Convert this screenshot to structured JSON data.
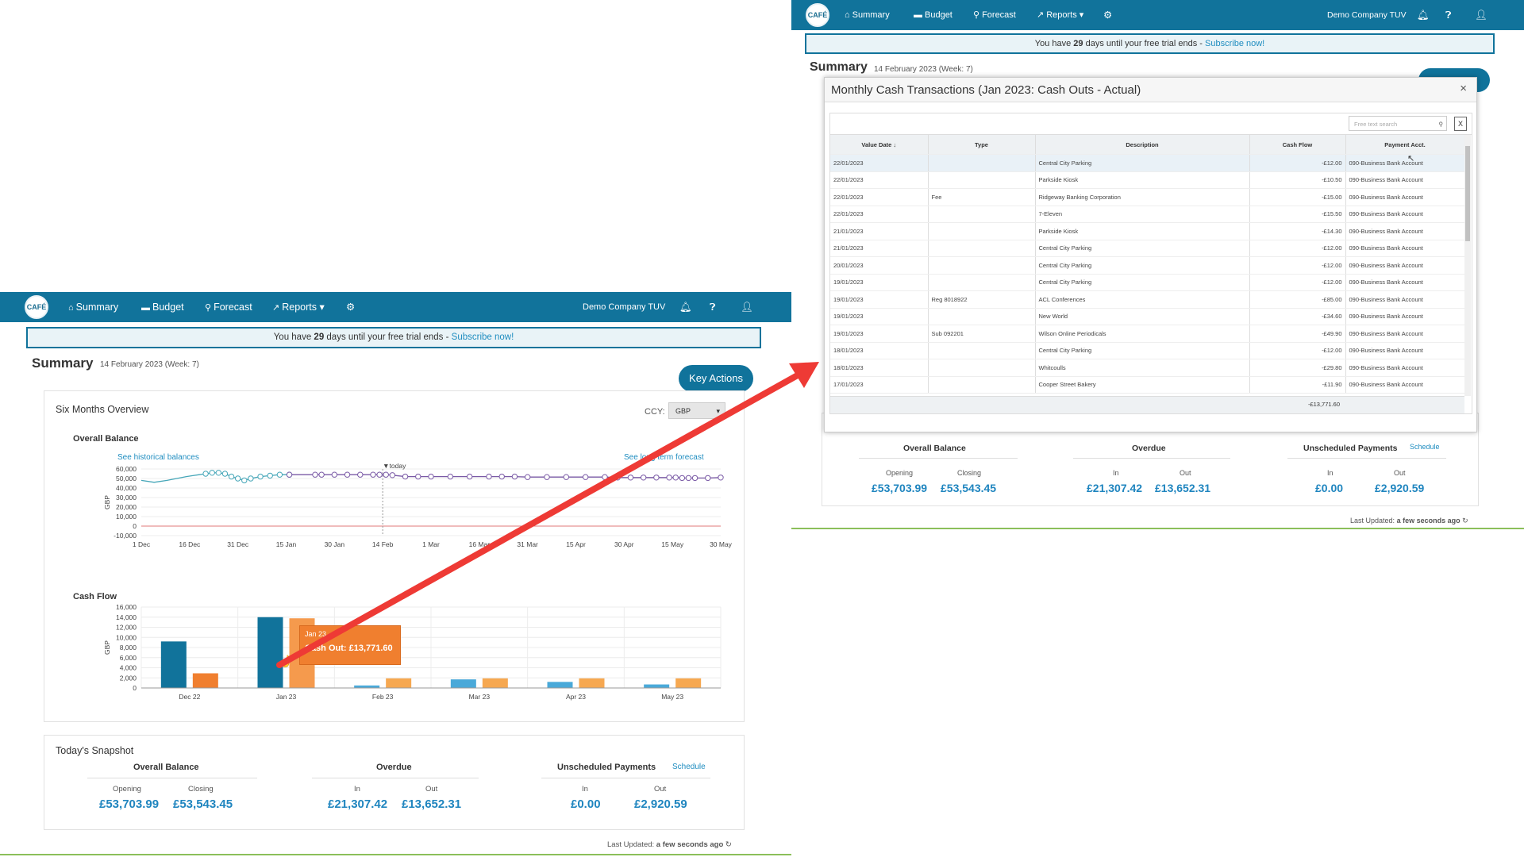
{
  "nav": {
    "logo": "CAFÉ",
    "items": [
      "Summary",
      "Budget",
      "Forecast",
      "Reports ▾"
    ],
    "company": "Demo Company TUV"
  },
  "trial": {
    "pre": "You have ",
    "days": "29",
    "post": " days until your free trial ends",
    "sep": " - ",
    "link": "Subscribe now!"
  },
  "summary": {
    "title": "Summary",
    "subtitle": "14 February 2023  (Week: 7)",
    "key_actions": "Key Actions"
  },
  "overview": {
    "title": "Six Months Overview",
    "ccy_label": "CCY:",
    "ccy_value": "GBP",
    "balance_title": "Overall Balance",
    "historical_link": "See historical balances",
    "forecast_link": "See long term forecast",
    "cashflow_title": "Cash Flow",
    "tooltip_month": "Jan 23",
    "tooltip_text": "Cash Out: £13,771.60"
  },
  "chart_data": [
    {
      "type": "line",
      "title": "Overall Balance",
      "ylabel": "GBP",
      "x_ticks": [
        "1 Dec",
        "16 Dec",
        "31 Dec",
        "15 Jan",
        "30 Jan",
        "14 Feb",
        "1 Mar",
        "16 Mar",
        "31 Mar",
        "15 Apr",
        "30 Apr",
        "15 May",
        "30 May"
      ],
      "y_ticks": [
        -10000,
        0,
        10000,
        20000,
        30000,
        40000,
        50000,
        60000
      ],
      "ylim": [
        -10000,
        60000
      ],
      "annotation": "today",
      "series": [
        {
          "values_x": [
            0,
            4,
            8,
            11,
            14,
            16,
            18,
            20,
            22,
            24,
            26,
            28,
            30,
            32,
            34,
            37,
            40,
            43,
            46
          ],
          "values_y": [
            48000,
            46000,
            48000,
            50000,
            52000,
            53000,
            54000,
            55000,
            56000,
            56000,
            55000,
            52000,
            50000,
            48000,
            50000,
            52000,
            53000,
            54000,
            54000
          ]
        },
        {
          "values_x": [
            46,
            54,
            56,
            60,
            64,
            68,
            72,
            74,
            76,
            78,
            82,
            86,
            90,
            96,
            102,
            108,
            112,
            116,
            120,
            126,
            132,
            138,
            144,
            148,
            152,
            156,
            160,
            164,
            166,
            168,
            170,
            172,
            176,
            180
          ],
          "values_y": [
            54000,
            54000,
            54000,
            54000,
            54000,
            54000,
            54000,
            54000,
            54000,
            53500,
            52000,
            52000,
            52000,
            52000,
            52000,
            52000,
            52000,
            52000,
            51500,
            51500,
            51500,
            51500,
            51500,
            51000,
            51000,
            51000,
            51000,
            51000,
            51000,
            50500,
            50500,
            50500,
            50500,
            51000
          ]
        }
      ]
    },
    {
      "type": "bar",
      "title": "Cash Flow",
      "ylabel": "GBP",
      "categories": [
        "Dec 22",
        "Jan 23",
        "Feb 23",
        "Mar 23",
        "Apr 23",
        "May 23"
      ],
      "y_ticks": [
        0,
        2000,
        4000,
        6000,
        8000,
        10000,
        12000,
        14000,
        16000
      ],
      "ylim": [
        0,
        16000
      ],
      "series": [
        {
          "values": [
            9200,
            14000,
            500,
            1700,
            1200,
            700
          ],
          "color": "#11739b"
        },
        {
          "values": [
            2900,
            13771.6,
            1900,
            1900,
            1900,
            1900
          ],
          "color": "#f07f2f"
        }
      ]
    }
  ],
  "snapshot": {
    "title": "Today's Snapshot",
    "balance_title": "Overall Balance",
    "overdue_title": "Overdue",
    "unscheduled_title": "Unscheduled Payments",
    "schedule_link": "Schedule",
    "opening_label": "Opening",
    "closing_label": "Closing",
    "in_label": "In",
    "out_label": "Out",
    "opening": "£53,703.99",
    "closing": "£53,543.45",
    "overdue_in": "£21,307.42",
    "overdue_out": "£13,652.31",
    "unsched_in": "£0.00",
    "unsched_out": "£2,920.59"
  },
  "last_updated": {
    "label": "Last Updated:",
    "value": "a few seconds ago"
  },
  "modal": {
    "title": "Monthly Cash Transactions (Jan 2023: Cash Outs - Actual)",
    "search_placeholder": "Free text search",
    "columns": [
      "Value Date",
      "Type",
      "Description",
      "Cash Flow",
      "Payment Acct."
    ],
    "rows": [
      [
        "22/01/2023",
        "",
        "Central City Parking",
        "-£12.00",
        "090-Business Bank Account"
      ],
      [
        "22/01/2023",
        "",
        "Parkside Kiosk",
        "-£10.50",
        "090-Business Bank Account"
      ],
      [
        "22/01/2023",
        "Fee",
        "Ridgeway Banking Corporation",
        "-£15.00",
        "090-Business Bank Account"
      ],
      [
        "22/01/2023",
        "",
        "7-Eleven",
        "-£15.50",
        "090-Business Bank Account"
      ],
      [
        "21/01/2023",
        "",
        "Parkside Kiosk",
        "-£14.30",
        "090-Business Bank Account"
      ],
      [
        "21/01/2023",
        "",
        "Central City Parking",
        "-£12.00",
        "090-Business Bank Account"
      ],
      [
        "20/01/2023",
        "",
        "Central City Parking",
        "-£12.00",
        "090-Business Bank Account"
      ],
      [
        "19/01/2023",
        "",
        "Central City Parking",
        "-£12.00",
        "090-Business Bank Account"
      ],
      [
        "19/01/2023",
        "Reg 8018922",
        "ACL Conferences",
        "-£85.00",
        "090-Business Bank Account"
      ],
      [
        "19/01/2023",
        "",
        "New World",
        "-£34.60",
        "090-Business Bank Account"
      ],
      [
        "19/01/2023",
        "Sub 092201",
        "Wilson Online Periodicals",
        "-£49.90",
        "090-Business Bank Account"
      ],
      [
        "18/01/2023",
        "",
        "Central City Parking",
        "-£12.00",
        "090-Business Bank Account"
      ],
      [
        "18/01/2023",
        "",
        "Whitcoulls",
        "-£29.80",
        "090-Business Bank Account"
      ],
      [
        "17/01/2023",
        "",
        "Cooper Street Bakery",
        "-£11.90",
        "090-Business Bank Account"
      ]
    ],
    "total": "-£13,771.60",
    "close": "×"
  },
  "colors": {
    "nav": "#11739b",
    "accent": "#1f85bf",
    "orange": "#f07f2f",
    "arrow": "#ee3a35"
  }
}
